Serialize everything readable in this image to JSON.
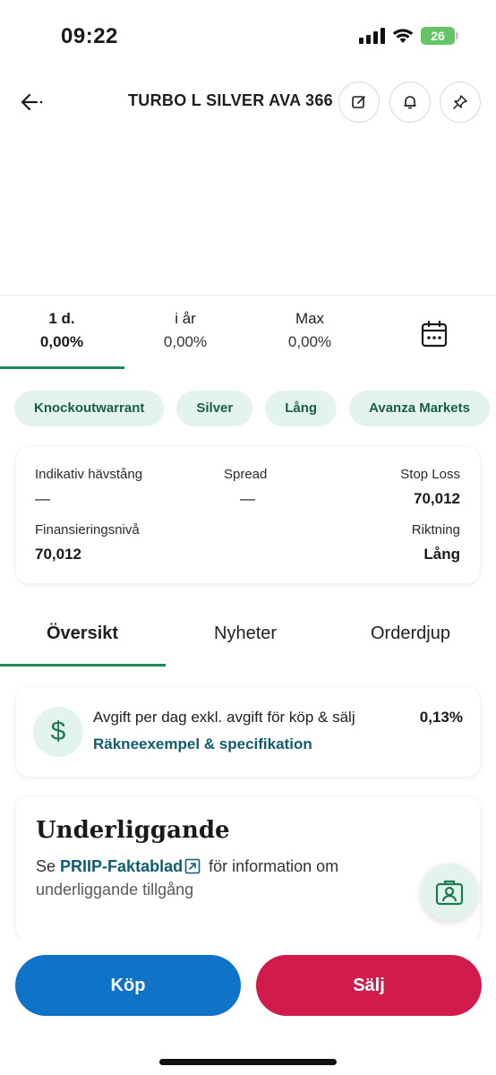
{
  "status_bar": {
    "time": "09:22",
    "battery": "26"
  },
  "header": {
    "title": "TURBO L SILVER AVA 366",
    "icons": [
      "back-arrow-icon",
      "edit-icon",
      "bell-icon",
      "pin-icon"
    ]
  },
  "periods": [
    {
      "label": "1 d.",
      "value": "0,00%"
    },
    {
      "label": "i år",
      "value": "0,00%"
    },
    {
      "label": "Max",
      "value": "0,00%"
    }
  ],
  "chips": [
    "Knockoutwarrant",
    "Silver",
    "Lång",
    "Avanza Markets"
  ],
  "info": {
    "leverage_label": "Indikativ hävstång",
    "leverage_value": "—",
    "spread_label": "Spread",
    "spread_value": "—",
    "stoploss_label": "Stop Loss",
    "stoploss_value": "70,012",
    "financing_label": "Finansieringsnivå",
    "financing_value": "70,012",
    "direction_label": "Riktning",
    "direction_value": "Lång"
  },
  "section_tabs": [
    "Översikt",
    "Nyheter",
    "Orderdjup"
  ],
  "fee": {
    "title": "Avgift per dag exkl. avgift för köp & sälj",
    "link": "Räkneexempel & specifikation",
    "value": "0,13%"
  },
  "underlying": {
    "title": "Underliggande",
    "prefix": "Se",
    "link": "PRIIP-Faktablad",
    "middle": "för information om",
    "suffix": "underliggande tillgång"
  },
  "actions": {
    "buy": "Köp",
    "sell": "Sälj"
  },
  "colors": {
    "accent": "#1e8a5c",
    "chip_bg": "#e3f4ed",
    "link": "#0f5d6e",
    "buy": "#0f73c8",
    "sell": "#d11b4b"
  }
}
